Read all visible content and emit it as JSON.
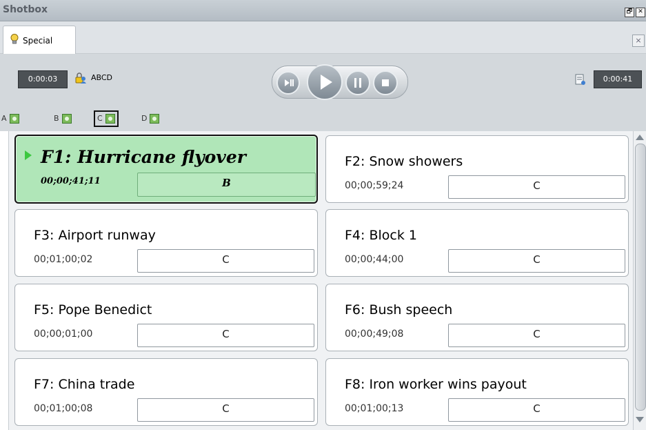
{
  "window": {
    "title": "Shotbox",
    "restore_label": "🗗",
    "close_label": "✕"
  },
  "tabs": [
    {
      "label": "Special"
    }
  ],
  "tab_close_label": "×",
  "toolbar": {
    "elapsed_time": "0:00:03",
    "user_label": "ABCD",
    "remaining_time": "0:00:41",
    "icons": {
      "lock": "user-lock-icon",
      "list": "playlist-icon"
    }
  },
  "transport": {
    "buttons": [
      "play-pause-step",
      "play",
      "pause",
      "stop"
    ]
  },
  "banks": [
    {
      "label": "A",
      "selected": false
    },
    {
      "label": "B",
      "selected": false
    },
    {
      "label": "C",
      "selected": true
    },
    {
      "label": "D",
      "selected": false
    }
  ],
  "shots": [
    {
      "key": "F1",
      "title": "F1: Hurricane flyover",
      "timecode": "00;00;41;11",
      "bank": "B",
      "active": true
    },
    {
      "key": "F2",
      "title": "F2: Snow showers",
      "timecode": "00;00;59;24",
      "bank": "C",
      "active": false
    },
    {
      "key": "F3",
      "title": "F3: Airport runway",
      "timecode": "00;01;00;02",
      "bank": "C",
      "active": false
    },
    {
      "key": "F4",
      "title": "F4: Block 1",
      "timecode": "00;00;44;00",
      "bank": "C",
      "active": false
    },
    {
      "key": "F5",
      "title": "F5: Pope Benedict",
      "timecode": "00;00;01;00",
      "bank": "C",
      "active": false
    },
    {
      "key": "F6",
      "title": "F6: Bush speech",
      "timecode": "00;00;49;08",
      "bank": "C",
      "active": false
    },
    {
      "key": "F7",
      "title": "F7: China trade",
      "timecode": "00;01;00;08",
      "bank": "C",
      "active": false
    },
    {
      "key": "F8",
      "title": "F8: Iron worker wins payout",
      "timecode": "00;01;00;13",
      "bank": "C",
      "active": false
    }
  ],
  "colors": {
    "active_card": "#b0e6b8",
    "play_indicator": "#3cc840",
    "timebox": "#4c5155"
  }
}
